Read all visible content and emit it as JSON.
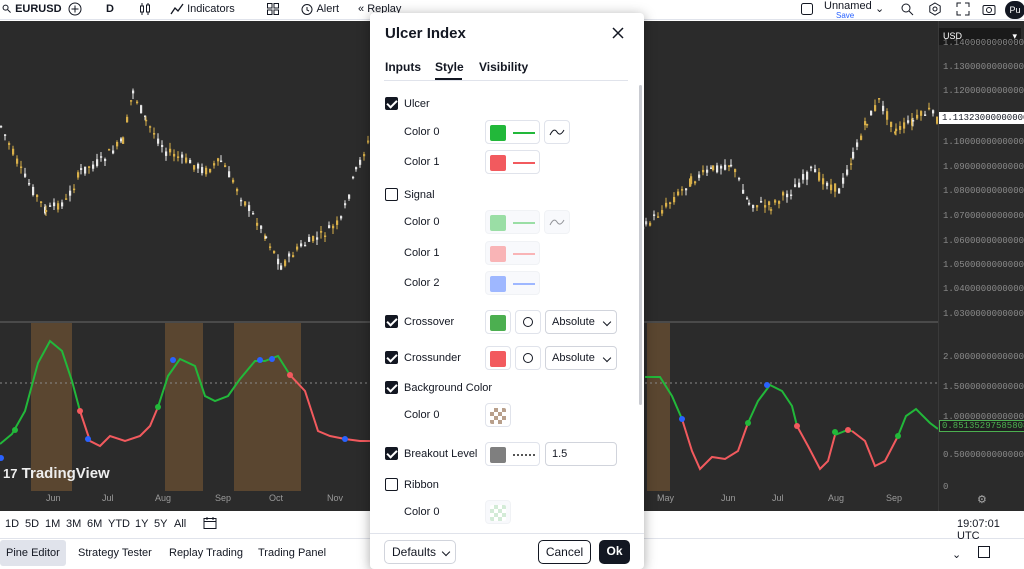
{
  "topbar": {
    "symbol": "EURUSD",
    "interval": "D",
    "indicators": "Indicators",
    "alert": "Alert",
    "replay": "Replay",
    "layout_name": "Unnamed",
    "save": "Save",
    "avatar": "Pu"
  },
  "price_axis": {
    "currency": "USD",
    "labels": [
      "1.14000000000000",
      "1.13000000000000",
      "1.12000000000000",
      "1.11323000000000",
      "1.10000000000000",
      "1.09000000000000",
      "1.08000000000000",
      "1.07000000000000",
      "1.06000000000000",
      "1.05000000000000",
      "1.04000000000000",
      "1.03000000000000",
      "2.00000000000000",
      "1.50000000000000",
      "1.00000000000000",
      "0.85135297585808",
      "0.50000000000000",
      "0"
    ],
    "current_price": "1.11323000000000",
    "current_osc": "0.85135297585808"
  },
  "time_axis": [
    "Jun",
    "Jul",
    "Aug",
    "Sep",
    "Oct",
    "Nov",
    "May",
    "Jun",
    "Jul",
    "Aug",
    "Sep"
  ],
  "watermark": "TradingView",
  "range_bar": {
    "ranges": [
      "1D",
      "5D",
      "1M",
      "3M",
      "6M",
      "YTD",
      "1Y",
      "5Y",
      "All"
    ],
    "time": "19:07:01 UTC"
  },
  "bottom_tabs": [
    "Pine Editor",
    "Strategy Tester",
    "Replay Trading",
    "Trading Panel"
  ],
  "dialog": {
    "title": "Ulcer Index",
    "tabs": [
      "Inputs",
      "Style",
      "Visibility"
    ],
    "active_tab": "Style",
    "rows": {
      "ulcer": "Ulcer",
      "signal": "Signal",
      "crossover": "Crossover",
      "crossunder": "Crossunder",
      "background": "Background Color",
      "breakout": "Breakout Level",
      "ribbon": "Ribbon",
      "color0": "Color 0",
      "color1": "Color 1",
      "color2": "Color 2"
    },
    "crossover_mode": "Absolute",
    "crossunder_mode": "Absolute",
    "breakout_value": "1.5",
    "defaults": "Defaults",
    "cancel": "Cancel",
    "ok": "Ok"
  },
  "colors": {
    "green": "#22b83a",
    "red": "#f25a5e",
    "signal_green": "#8fdc9c",
    "signal_red": "#f5a9aa",
    "signal_blue": "#8aa9e6",
    "crossover": "#4caf50",
    "crossunder": "#f25a5e",
    "breakout": "#7f7f7f"
  }
}
